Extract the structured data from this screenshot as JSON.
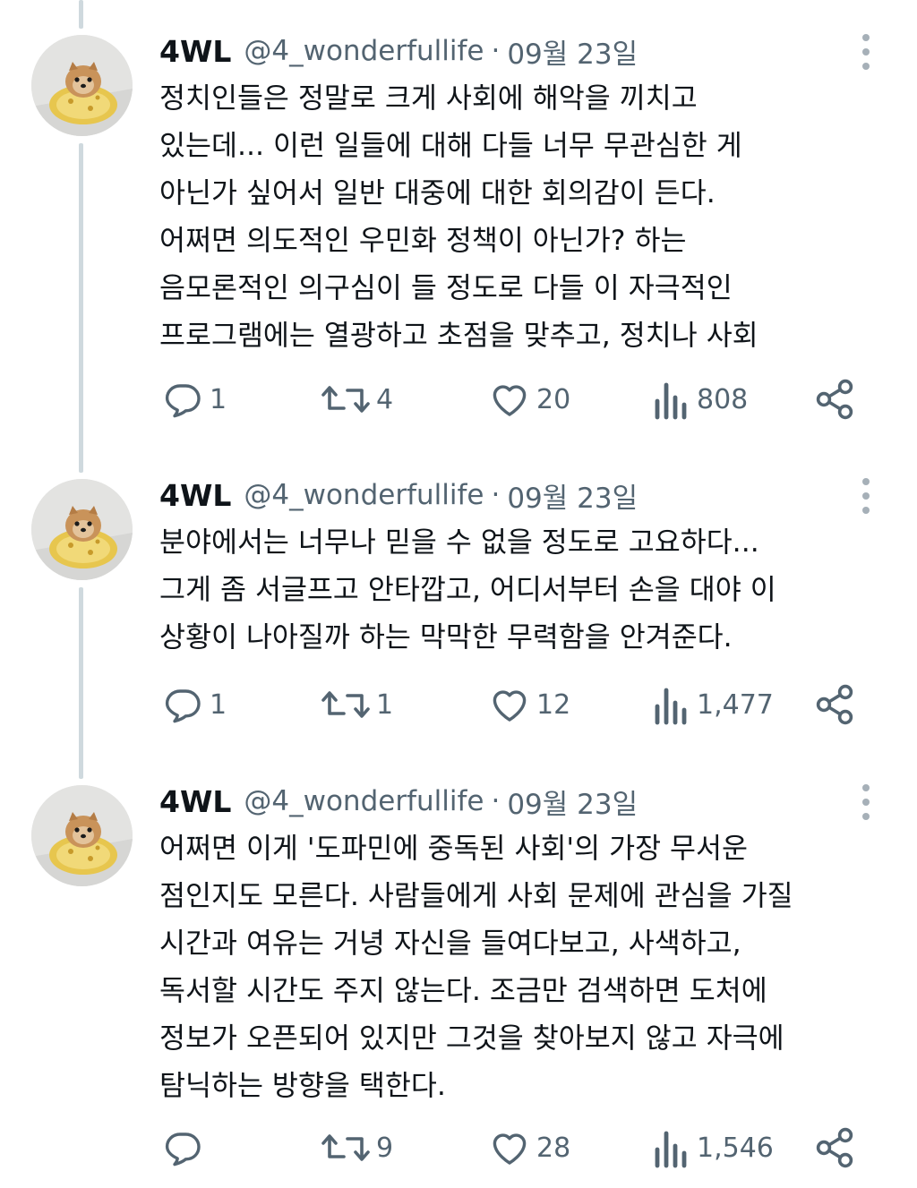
{
  "colors": {
    "text": "#0f1419",
    "secondary": "#536471",
    "thread_line": "#cfd9de",
    "more_dots": "#a6b0b8"
  },
  "icons": [
    "reply-icon",
    "retweet-icon",
    "like-icon",
    "views-icon",
    "share-icon",
    "more-icon"
  ],
  "tweets": [
    {
      "name": "4WL",
      "handle": "@4_wonderfullife",
      "separator": "·",
      "date": "09월 23일",
      "lines": [
        "정치인들은 정말로 크게 사회에 해악을 끼치고",
        "있는데... 이런 일들에 대해 다들 너무 무관심한 게",
        "아닌가 싶어서 일반 대중에 대한 회의감이 든다.",
        "어쩌면 의도적인 우민화 정책이 아닌가? 하는",
        "음모론적인 의구심이 들 정도로 다들 이 자극적인",
        "프로그램에는 열광하고 초점을 맞추고, 정치나 사회"
      ],
      "replies": "1",
      "retweets": "4",
      "likes": "20",
      "views": "808"
    },
    {
      "name": "4WL",
      "handle": "@4_wonderfullife",
      "separator": "·",
      "date": "09월 23일",
      "lines": [
        "분야에서는 너무나 믿을 수 없을 정도로 고요하다...",
        "그게 좀 서글프고 안타깝고, 어디서부터 손을 대야 이",
        "상황이 나아질까 하는 막막한 무력함을 안겨준다."
      ],
      "replies": "1",
      "retweets": "1",
      "likes": "12",
      "views": "1,477"
    },
    {
      "name": "4WL",
      "handle": "@4_wonderfullife",
      "separator": "·",
      "date": "09월 23일",
      "lines": [
        "어쩌면 이게 '도파민에 중독된 사회'의 가장 무서운",
        "점인지도 모른다. 사람들에게 사회 문제에 관심을 가질",
        "시간과 여유는 거녕 자신을 들여다보고, 사색하고,",
        "독서할 시간도 주지 않는다. 조금만 검색하면 도처에",
        "정보가 오픈되어 있지만 그것을 찾아보지 않고 자극에",
        "탐닉하는 방향을 택한다."
      ],
      "replies": "",
      "retweets": "9",
      "likes": "28",
      "views": "1,546"
    }
  ]
}
